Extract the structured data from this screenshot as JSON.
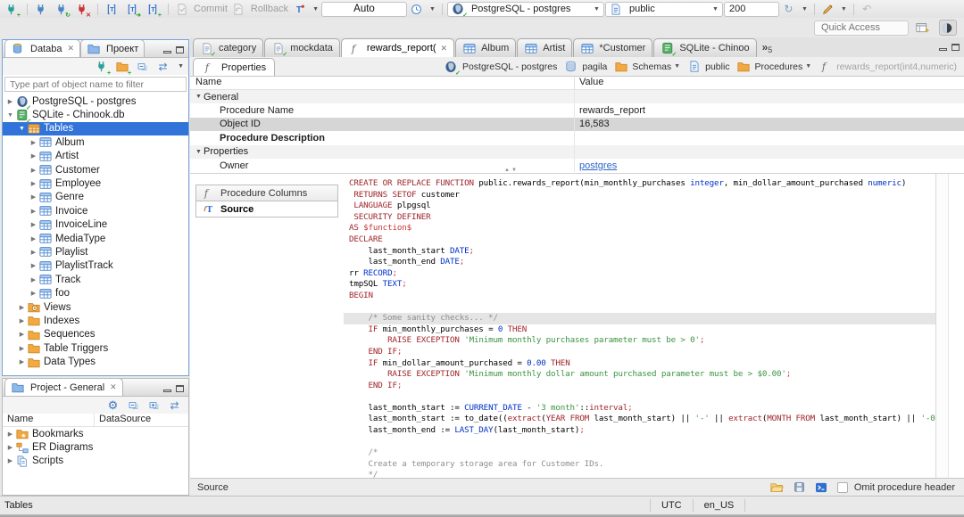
{
  "toolbar": {
    "auto": "Auto",
    "commit": "Commit",
    "rollback": "Rollback",
    "connection": "PostgreSQL - postgres",
    "schema": "public",
    "fetch_size": "200",
    "quick_access": "Quick Access"
  },
  "navigator": {
    "tabs": [
      {
        "label": "Databa"
      },
      {
        "label": "Проект"
      }
    ],
    "filter_placeholder": "Type part of object name to filter",
    "tree": [
      {
        "depth": 0,
        "arrow": "right",
        "icon": "pg",
        "label": "PostgreSQL - postgres"
      },
      {
        "depth": 0,
        "arrow": "down",
        "icon": "sqlite",
        "label": "SQLite - Chinook.db"
      },
      {
        "depth": 1,
        "arrow": "down",
        "icon": "tables",
        "label": "Tables",
        "selected": true
      },
      {
        "depth": 2,
        "arrow": "right",
        "icon": "table",
        "label": "Album"
      },
      {
        "depth": 2,
        "arrow": "right",
        "icon": "table",
        "label": "Artist"
      },
      {
        "depth": 2,
        "arrow": "right",
        "icon": "table",
        "label": "Customer"
      },
      {
        "depth": 2,
        "arrow": "right",
        "icon": "table",
        "label": "Employee"
      },
      {
        "depth": 2,
        "arrow": "right",
        "icon": "table",
        "label": "Genre"
      },
      {
        "depth": 2,
        "arrow": "right",
        "icon": "table",
        "label": "Invoice"
      },
      {
        "depth": 2,
        "arrow": "right",
        "icon": "table",
        "label": "InvoiceLine"
      },
      {
        "depth": 2,
        "arrow": "right",
        "icon": "table",
        "label": "MediaType"
      },
      {
        "depth": 2,
        "arrow": "right",
        "icon": "table",
        "label": "Playlist"
      },
      {
        "depth": 2,
        "arrow": "right",
        "icon": "table",
        "label": "PlaylistTrack"
      },
      {
        "depth": 2,
        "arrow": "right",
        "icon": "table",
        "label": "Track"
      },
      {
        "depth": 2,
        "arrow": "right",
        "icon": "table",
        "label": "foo"
      },
      {
        "depth": 1,
        "arrow": "right",
        "icon": "views",
        "label": "Views"
      },
      {
        "depth": 1,
        "arrow": "right",
        "icon": "folder",
        "label": "Indexes"
      },
      {
        "depth": 1,
        "arrow": "right",
        "icon": "folder",
        "label": "Sequences"
      },
      {
        "depth": 1,
        "arrow": "right",
        "icon": "folder",
        "label": "Table Triggers"
      },
      {
        "depth": 1,
        "arrow": "right",
        "icon": "folder",
        "label": "Data Types"
      }
    ]
  },
  "project": {
    "title": "Project - General",
    "columns": [
      "Name",
      "DataSource"
    ],
    "items": [
      {
        "icon": "bookmarks",
        "label": "Bookmarks"
      },
      {
        "icon": "erd",
        "label": "ER Diagrams"
      },
      {
        "icon": "scripts",
        "label": "Scripts"
      }
    ]
  },
  "editor": {
    "tabs": [
      {
        "icon": "sqlfile",
        "label": "category"
      },
      {
        "icon": "sqlfile",
        "label": "mockdata"
      },
      {
        "icon": "func",
        "label": "rewards_report(",
        "active": true,
        "closable": true
      },
      {
        "icon": "table",
        "label": "Album"
      },
      {
        "icon": "table",
        "label": "Artist"
      },
      {
        "icon": "table",
        "label": "*Customer"
      },
      {
        "icon": "sqlite",
        "label": "SQLite - Chinoo"
      }
    ],
    "overflow_count": "5",
    "properties_tab": "Properties",
    "breadcrumb": [
      {
        "icon": "pg",
        "label": "PostgreSQL - postgres"
      },
      {
        "icon": "db",
        "label": "pagila"
      },
      {
        "icon": "folder",
        "label": "Schemas",
        "dropdown": true
      },
      {
        "icon": "page",
        "label": "public"
      },
      {
        "icon": "folder",
        "label": "Procedures",
        "dropdown": true
      },
      {
        "icon": "func",
        "label": "rewards_report(int4,numeric)",
        "muted": true
      }
    ],
    "grid": {
      "columns": [
        "Name",
        "Value"
      ],
      "rows": [
        {
          "name": "General",
          "group": true,
          "value": ""
        },
        {
          "name": "Procedure Name",
          "value": "rewards_report"
        },
        {
          "name": "Object ID",
          "value": "16,583",
          "selected": true
        },
        {
          "name": "Procedure Description",
          "bold": true,
          "value": ""
        },
        {
          "name": "Properties",
          "group": true,
          "value": ""
        },
        {
          "name": "Owner",
          "value": "postgres",
          "link": true
        }
      ]
    },
    "side_tabs": [
      {
        "icon": "func",
        "label": "Procedure Columns"
      },
      {
        "icon": "source",
        "label": "Source",
        "active": true
      }
    ],
    "bottom": {
      "label": "Source",
      "omit_checkbox_label": "Omit procedure header"
    }
  },
  "code": {
    "highlight_line": 13,
    "lines": [
      [
        [
          "k",
          "CREATE OR REPLACE FUNCTION"
        ],
        [
          "p",
          " public.rewards_report(min_monthly_purchases "
        ],
        [
          "t",
          "integer"
        ],
        [
          "p",
          ", min_dollar_amount_purchased "
        ],
        [
          "t",
          "numeric"
        ],
        [
          "p",
          ")"
        ]
      ],
      [
        [
          "p",
          " "
        ],
        [
          "k",
          "RETURNS SETOF"
        ],
        [
          "p",
          " customer"
        ]
      ],
      [
        [
          "p",
          " "
        ],
        [
          "k",
          "LANGUAGE"
        ],
        [
          "p",
          " plpgsql"
        ]
      ],
      [
        [
          "p",
          " "
        ],
        [
          "k",
          "SECURITY DEFINER"
        ]
      ],
      [
        [
          "k",
          "AS"
        ],
        [
          "p",
          " "
        ],
        [
          "r",
          "$function$"
        ]
      ],
      [
        [
          "k",
          "DECLARE"
        ]
      ],
      [
        [
          "p",
          "    last_month_start "
        ],
        [
          "t",
          "DATE"
        ],
        [
          "r",
          ";"
        ]
      ],
      [
        [
          "p",
          "    last_month_end "
        ],
        [
          "t",
          "DATE"
        ],
        [
          "r",
          ";"
        ]
      ],
      [
        [
          "p",
          "rr "
        ],
        [
          "t",
          "RECORD"
        ],
        [
          "r",
          ";"
        ]
      ],
      [
        [
          "p",
          "tmpSQL "
        ],
        [
          "t",
          "TEXT"
        ],
        [
          "r",
          ";"
        ]
      ],
      [
        [
          "k",
          "BEGIN"
        ]
      ],
      [],
      [
        [
          "c",
          "    /* Some sanity checks... */"
        ]
      ],
      [
        [
          "p",
          "    "
        ],
        [
          "k",
          "IF"
        ],
        [
          "p",
          " min_monthly_purchases = "
        ],
        [
          "t",
          "0"
        ],
        [
          "p",
          " "
        ],
        [
          "k",
          "THEN"
        ]
      ],
      [
        [
          "p",
          "        "
        ],
        [
          "k",
          "RAISE EXCEPTION"
        ],
        [
          "p",
          " "
        ],
        [
          "s",
          "'Minimum monthly purchases parameter must be > 0'"
        ],
        [
          "r",
          ";"
        ]
      ],
      [
        [
          "p",
          "    "
        ],
        [
          "k",
          "END IF"
        ],
        [
          "r",
          ";"
        ]
      ],
      [
        [
          "p",
          "    "
        ],
        [
          "k",
          "IF"
        ],
        [
          "p",
          " min_dollar_amount_purchased = "
        ],
        [
          "t",
          "0.00"
        ],
        [
          "p",
          " "
        ],
        [
          "k",
          "THEN"
        ]
      ],
      [
        [
          "p",
          "        "
        ],
        [
          "k",
          "RAISE EXCEPTION"
        ],
        [
          "p",
          " "
        ],
        [
          "s",
          "'Minimum monthly dollar amount purchased parameter must be > $0.00'"
        ],
        [
          "r",
          ";"
        ]
      ],
      [
        [
          "p",
          "    "
        ],
        [
          "k",
          "END IF"
        ],
        [
          "r",
          ";"
        ]
      ],
      [],
      [
        [
          "p",
          "    last_month_start := "
        ],
        [
          "t",
          "CURRENT_DATE"
        ],
        [
          "p",
          " - "
        ],
        [
          "s",
          "'3 month'"
        ],
        [
          "p",
          "::"
        ],
        [
          "k",
          "interval"
        ],
        [
          "r",
          ";"
        ]
      ],
      [
        [
          "p",
          "    last_month_start := to_date(("
        ],
        [
          "k",
          "extract"
        ],
        [
          "p",
          "("
        ],
        [
          "k",
          "YEAR FROM"
        ],
        [
          "p",
          " last_month_start) || "
        ],
        [
          "s",
          "'-'"
        ],
        [
          "p",
          " || "
        ],
        [
          "k",
          "extract"
        ],
        [
          "p",
          "("
        ],
        [
          "k",
          "MONTH FROM"
        ],
        [
          "p",
          " last_month_start) || "
        ],
        [
          "s",
          "'-0"
        ]
      ],
      [
        [
          "p",
          "    last_month_end := "
        ],
        [
          "t",
          "LAST_DAY"
        ],
        [
          "p",
          "(last_month_start)"
        ],
        [
          "r",
          ";"
        ]
      ],
      [],
      [
        [
          "c",
          "    /*"
        ]
      ],
      [
        [
          "c",
          "    Create a temporary storage area for Customer IDs."
        ]
      ],
      [
        [
          "c",
          "    */"
        ]
      ]
    ]
  },
  "statusbar": {
    "left": "Tables",
    "timezone": "UTC",
    "locale": "en_US"
  }
}
